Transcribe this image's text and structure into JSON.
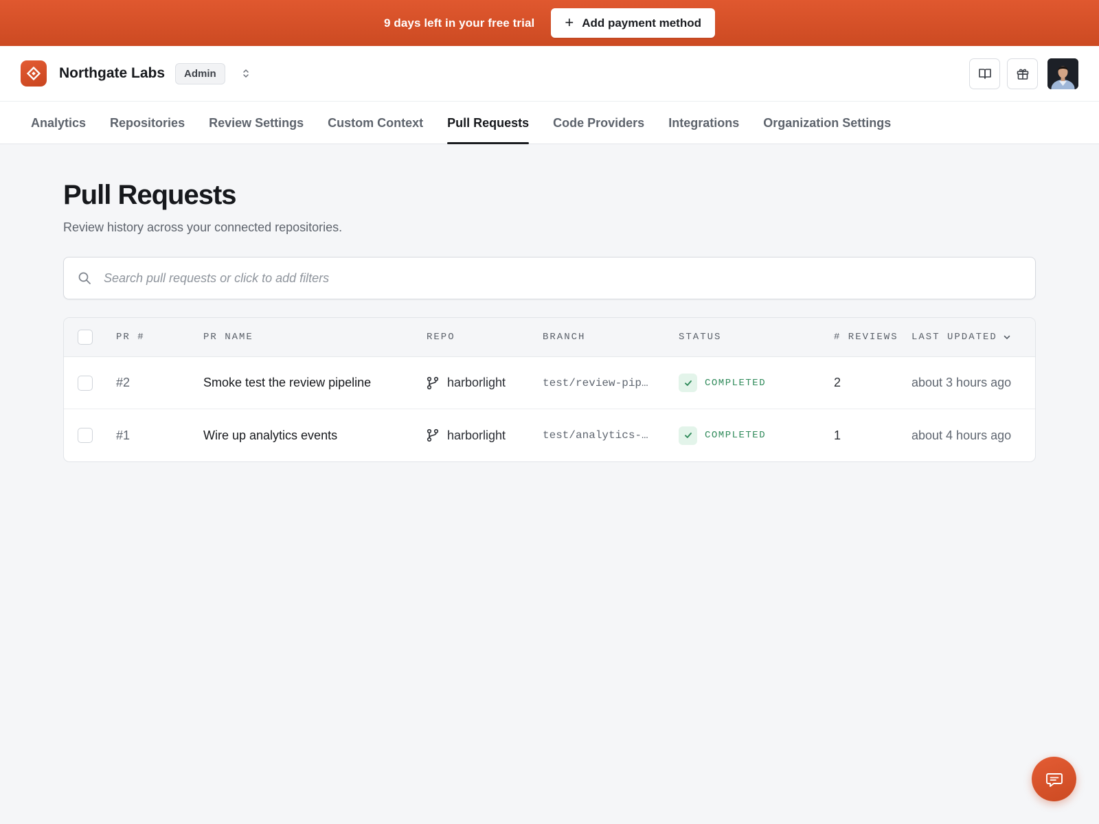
{
  "banner": {
    "trial_text": "9 days left in your free trial",
    "cta_label": "Add payment method"
  },
  "header": {
    "org_name": "Northgate Labs",
    "role_badge": "Admin"
  },
  "tabs": [
    {
      "label": "Analytics",
      "active": false
    },
    {
      "label": "Repositories",
      "active": false
    },
    {
      "label": "Review Settings",
      "active": false
    },
    {
      "label": "Custom Context",
      "active": false
    },
    {
      "label": "Pull Requests",
      "active": true
    },
    {
      "label": "Code Providers",
      "active": false
    },
    {
      "label": "Integrations",
      "active": false
    },
    {
      "label": "Organization Settings",
      "active": false
    }
  ],
  "page": {
    "title": "Pull Requests",
    "subtitle": "Review history across your connected repositories."
  },
  "search": {
    "placeholder": "Search pull requests or click to add filters"
  },
  "table": {
    "columns": {
      "pr_num": "PR #",
      "pr_name": "PR NAME",
      "repo": "REPO",
      "branch": "BRANCH",
      "status": "STATUS",
      "reviews": "# REVIEWS",
      "last_updated": "LAST UPDATED"
    },
    "rows": [
      {
        "pr_num": "#2",
        "pr_name": "Smoke test the review pipeline",
        "repo": "harborlight",
        "branch": "test/review-pip…",
        "status": "COMPLETED",
        "reviews": "2",
        "last_updated": "about 3 hours ago"
      },
      {
        "pr_num": "#1",
        "pr_name": "Wire up analytics events",
        "repo": "harborlight",
        "branch": "test/analytics-…",
        "status": "COMPLETED",
        "reviews": "1",
        "last_updated": "about 4 hours ago"
      }
    ]
  },
  "colors": {
    "brand": "#d9532b",
    "status_success": "#2f8a5a"
  },
  "icons": {
    "logo": "diamond-logo-icon",
    "org_switch": "chevron-up-down-icon",
    "docs": "book-icon",
    "gift": "gift-icon",
    "search": "search-icon",
    "repo": "git-branch-icon",
    "status": "check-icon",
    "sort": "chevron-down-icon",
    "chat": "chat-icon"
  }
}
